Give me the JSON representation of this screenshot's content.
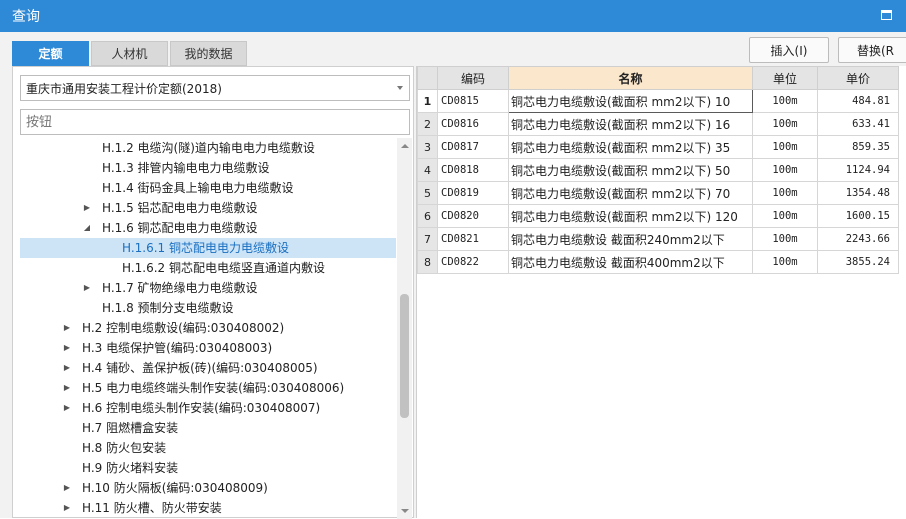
{
  "window": {
    "title": "查询"
  },
  "tabs": [
    {
      "label": "定额",
      "active": true
    },
    {
      "label": "人材机",
      "active": false
    },
    {
      "label": "我的数据",
      "active": false
    }
  ],
  "toolbar": {
    "insert_label": "插入(I)",
    "replace_label": "替换(R"
  },
  "library_select": {
    "value": "重庆市通用安装工程计价定额(2018)"
  },
  "search": {
    "placeholder": "按钮"
  },
  "tree": [
    {
      "label": "H.1.2 电缆沟(隧)道内输电电力电缆敷设",
      "level": 2,
      "expander": ""
    },
    {
      "label": "H.1.3 排管内输电电力电缆敷设",
      "level": 2,
      "expander": ""
    },
    {
      "label": "H.1.4 街码金具上输电电力电缆敷设",
      "level": 2,
      "expander": ""
    },
    {
      "label": "H.1.5 铝芯配电电力电缆敷设",
      "level": 2,
      "expander": "collapsed"
    },
    {
      "label": "H.1.6 铜芯配电电力电缆敷设",
      "level": 2,
      "expander": "expanded"
    },
    {
      "label": "H.1.6.1 铜芯配电电力电缆敷设",
      "level": 3,
      "expander": "",
      "selected": true
    },
    {
      "label": "H.1.6.2 铜芯配电电缆竖直通道内敷设",
      "level": 3,
      "expander": ""
    },
    {
      "label": "H.1.7 矿物绝缘电力电缆敷设",
      "level": 2,
      "expander": "collapsed"
    },
    {
      "label": "H.1.8 预制分支电缆敷设",
      "level": 2,
      "expander": ""
    },
    {
      "label": "H.2 控制电缆敷设(编码:030408002)",
      "level": 1,
      "expander": "collapsed"
    },
    {
      "label": "H.3 电缆保护管(编码:030408003)",
      "level": 1,
      "expander": "collapsed"
    },
    {
      "label": "H.4 铺砂、盖保护板(砖)(编码:030408005)",
      "level": 1,
      "expander": "collapsed"
    },
    {
      "label": "H.5 电力电缆终端头制作安装(编码:030408006)",
      "level": 1,
      "expander": "collapsed"
    },
    {
      "label": "H.6 控制电缆头制作安装(编码:030408007)",
      "level": 1,
      "expander": "collapsed"
    },
    {
      "label": "H.7 阻燃槽盒安装",
      "level": 1,
      "expander": ""
    },
    {
      "label": "H.8 防火包安装",
      "level": 1,
      "expander": ""
    },
    {
      "label": "H.9 防火堵料安装",
      "level": 1,
      "expander": ""
    },
    {
      "label": "H.10 防火隔板(编码:030408009)",
      "level": 1,
      "expander": "collapsed"
    },
    {
      "label": "H.11 防火槽、防火带安装",
      "level": 1,
      "expander": "collapsed"
    }
  ],
  "table": {
    "columns": {
      "index": "",
      "code": "编码",
      "name": "名称",
      "unit": "单位",
      "price": "单价"
    },
    "rows": [
      {
        "index": "1",
        "code": "CD0815",
        "name": "铜芯电力电缆敷设(截面积 mm2以下) 10",
        "unit": "100m",
        "price": "484.81"
      },
      {
        "index": "2",
        "code": "CD0816",
        "name": "铜芯电力电缆敷设(截面积 mm2以下) 16",
        "unit": "100m",
        "price": "633.41"
      },
      {
        "index": "3",
        "code": "CD0817",
        "name": "铜芯电力电缆敷设(截面积 mm2以下) 35",
        "unit": "100m",
        "price": "859.35"
      },
      {
        "index": "4",
        "code": "CD0818",
        "name": "铜芯电力电缆敷设(截面积 mm2以下) 50",
        "unit": "100m",
        "price": "1124.94"
      },
      {
        "index": "5",
        "code": "CD0819",
        "name": "铜芯电力电缆敷设(截面积 mm2以下) 70",
        "unit": "100m",
        "price": "1354.48"
      },
      {
        "index": "6",
        "code": "CD0820",
        "name": "铜芯电力电缆敷设(截面积 mm2以下) 120",
        "unit": "100m",
        "price": "1600.15"
      },
      {
        "index": "7",
        "code": "CD0821",
        "name": "铜芯电力电缆敷设 截面积240mm2以下",
        "unit": "100m",
        "price": "2243.66"
      },
      {
        "index": "8",
        "code": "CD0822",
        "name": "铜芯电力电缆敷设 截面积400mm2以下",
        "unit": "100m",
        "price": "3855.24"
      }
    ]
  },
  "colors": {
    "accent": "#2e89d6",
    "selected_row": "#cde4f7",
    "name_header": "#fbe7cc"
  }
}
